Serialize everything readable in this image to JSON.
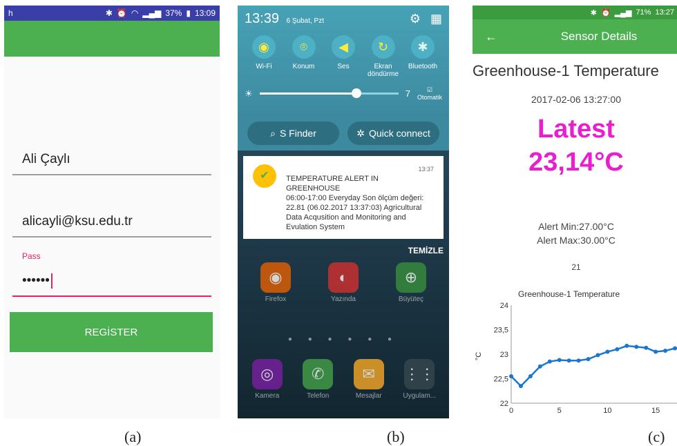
{
  "captions": {
    "a": "(a)",
    "b": "(b)",
    "c": "(c)"
  },
  "panel_a": {
    "status": {
      "left": "h",
      "battery": "37%",
      "time": "13:09"
    },
    "name_value": "Ali Çaylı",
    "email_value": "alicayli@ksu.edu.tr",
    "pass_label": "Pass",
    "pass_value": "••••••",
    "register_label": "REGİSTER",
    "accent_color": "#4caf50",
    "focus_color": "#e91e63"
  },
  "panel_b": {
    "time": "13:39",
    "date": "6 Şubat, Pzt",
    "quick_settings": [
      {
        "label": "Wi-Fi",
        "icon": "wifi-icon"
      },
      {
        "label": "Konum",
        "icon": "location-icon"
      },
      {
        "label": "Ses",
        "icon": "volume-icon"
      },
      {
        "label": "Ekran döndürme",
        "icon": "rotate-icon"
      },
      {
        "label": "Bluetooth",
        "icon": "bluetooth-icon"
      }
    ],
    "brightness_value": "7",
    "brightness_level": 0.7,
    "auto_label": "Otomatik",
    "s_finder": "S Finder",
    "quick_connect": "Quick connect",
    "notification": {
      "time": "13:37",
      "title": "TEMPERATURE ALERT IN GREENHOUSE",
      "body": "06:00-17:00 Everyday Son ölçüm değeri: 22.81 (06.02.2017 13:37:03) Agricultural Data Acqusition and Monitoring and Evulation System"
    },
    "clear_label": "TEMİZLE",
    "apps_row1": [
      "Firefox",
      "Yazında",
      "Büyüteç"
    ],
    "apps_row2": [
      "Kamera",
      "Telefon",
      "Mesajlar",
      "Uygulam..."
    ]
  },
  "panel_c": {
    "status": {
      "battery": "71%",
      "time": "13:27"
    },
    "title": "Sensor Details",
    "heading": "Greenhouse-1 Temperature",
    "timestamp": "2017-02-06 13:27:00",
    "latest_label": "Latest",
    "latest_value": "23,14°C",
    "alert_min": "Alert Min:27.00°C",
    "alert_max": "Alert Max:30.00°C",
    "count": "21",
    "highlight_color": "#e91ecf"
  },
  "chart_data": {
    "type": "line",
    "title": "Greenhouse-1 Temperature",
    "xlabel": "",
    "ylabel": "°C",
    "xlim": [
      0,
      17.5
    ],
    "ylim": [
      22,
      24
    ],
    "x_ticks": [
      "0",
      "5",
      "10",
      "15"
    ],
    "y_ticks": [
      "22",
      "22,5",
      "23",
      "23,5",
      "24"
    ],
    "grid": false,
    "series": [
      {
        "x": [
          0,
          1,
          2,
          3,
          4,
          5,
          6,
          7,
          8,
          9,
          10,
          11,
          12,
          13,
          14,
          15,
          16,
          17,
          18
        ],
        "values": [
          22.55,
          22.35,
          22.55,
          22.75,
          22.85,
          22.88,
          22.87,
          22.87,
          22.9,
          22.98,
          23.05,
          23.1,
          23.17,
          23.15,
          23.13,
          23.05,
          23.07,
          23.12,
          23.15
        ],
        "color": "#1976d2"
      }
    ]
  }
}
